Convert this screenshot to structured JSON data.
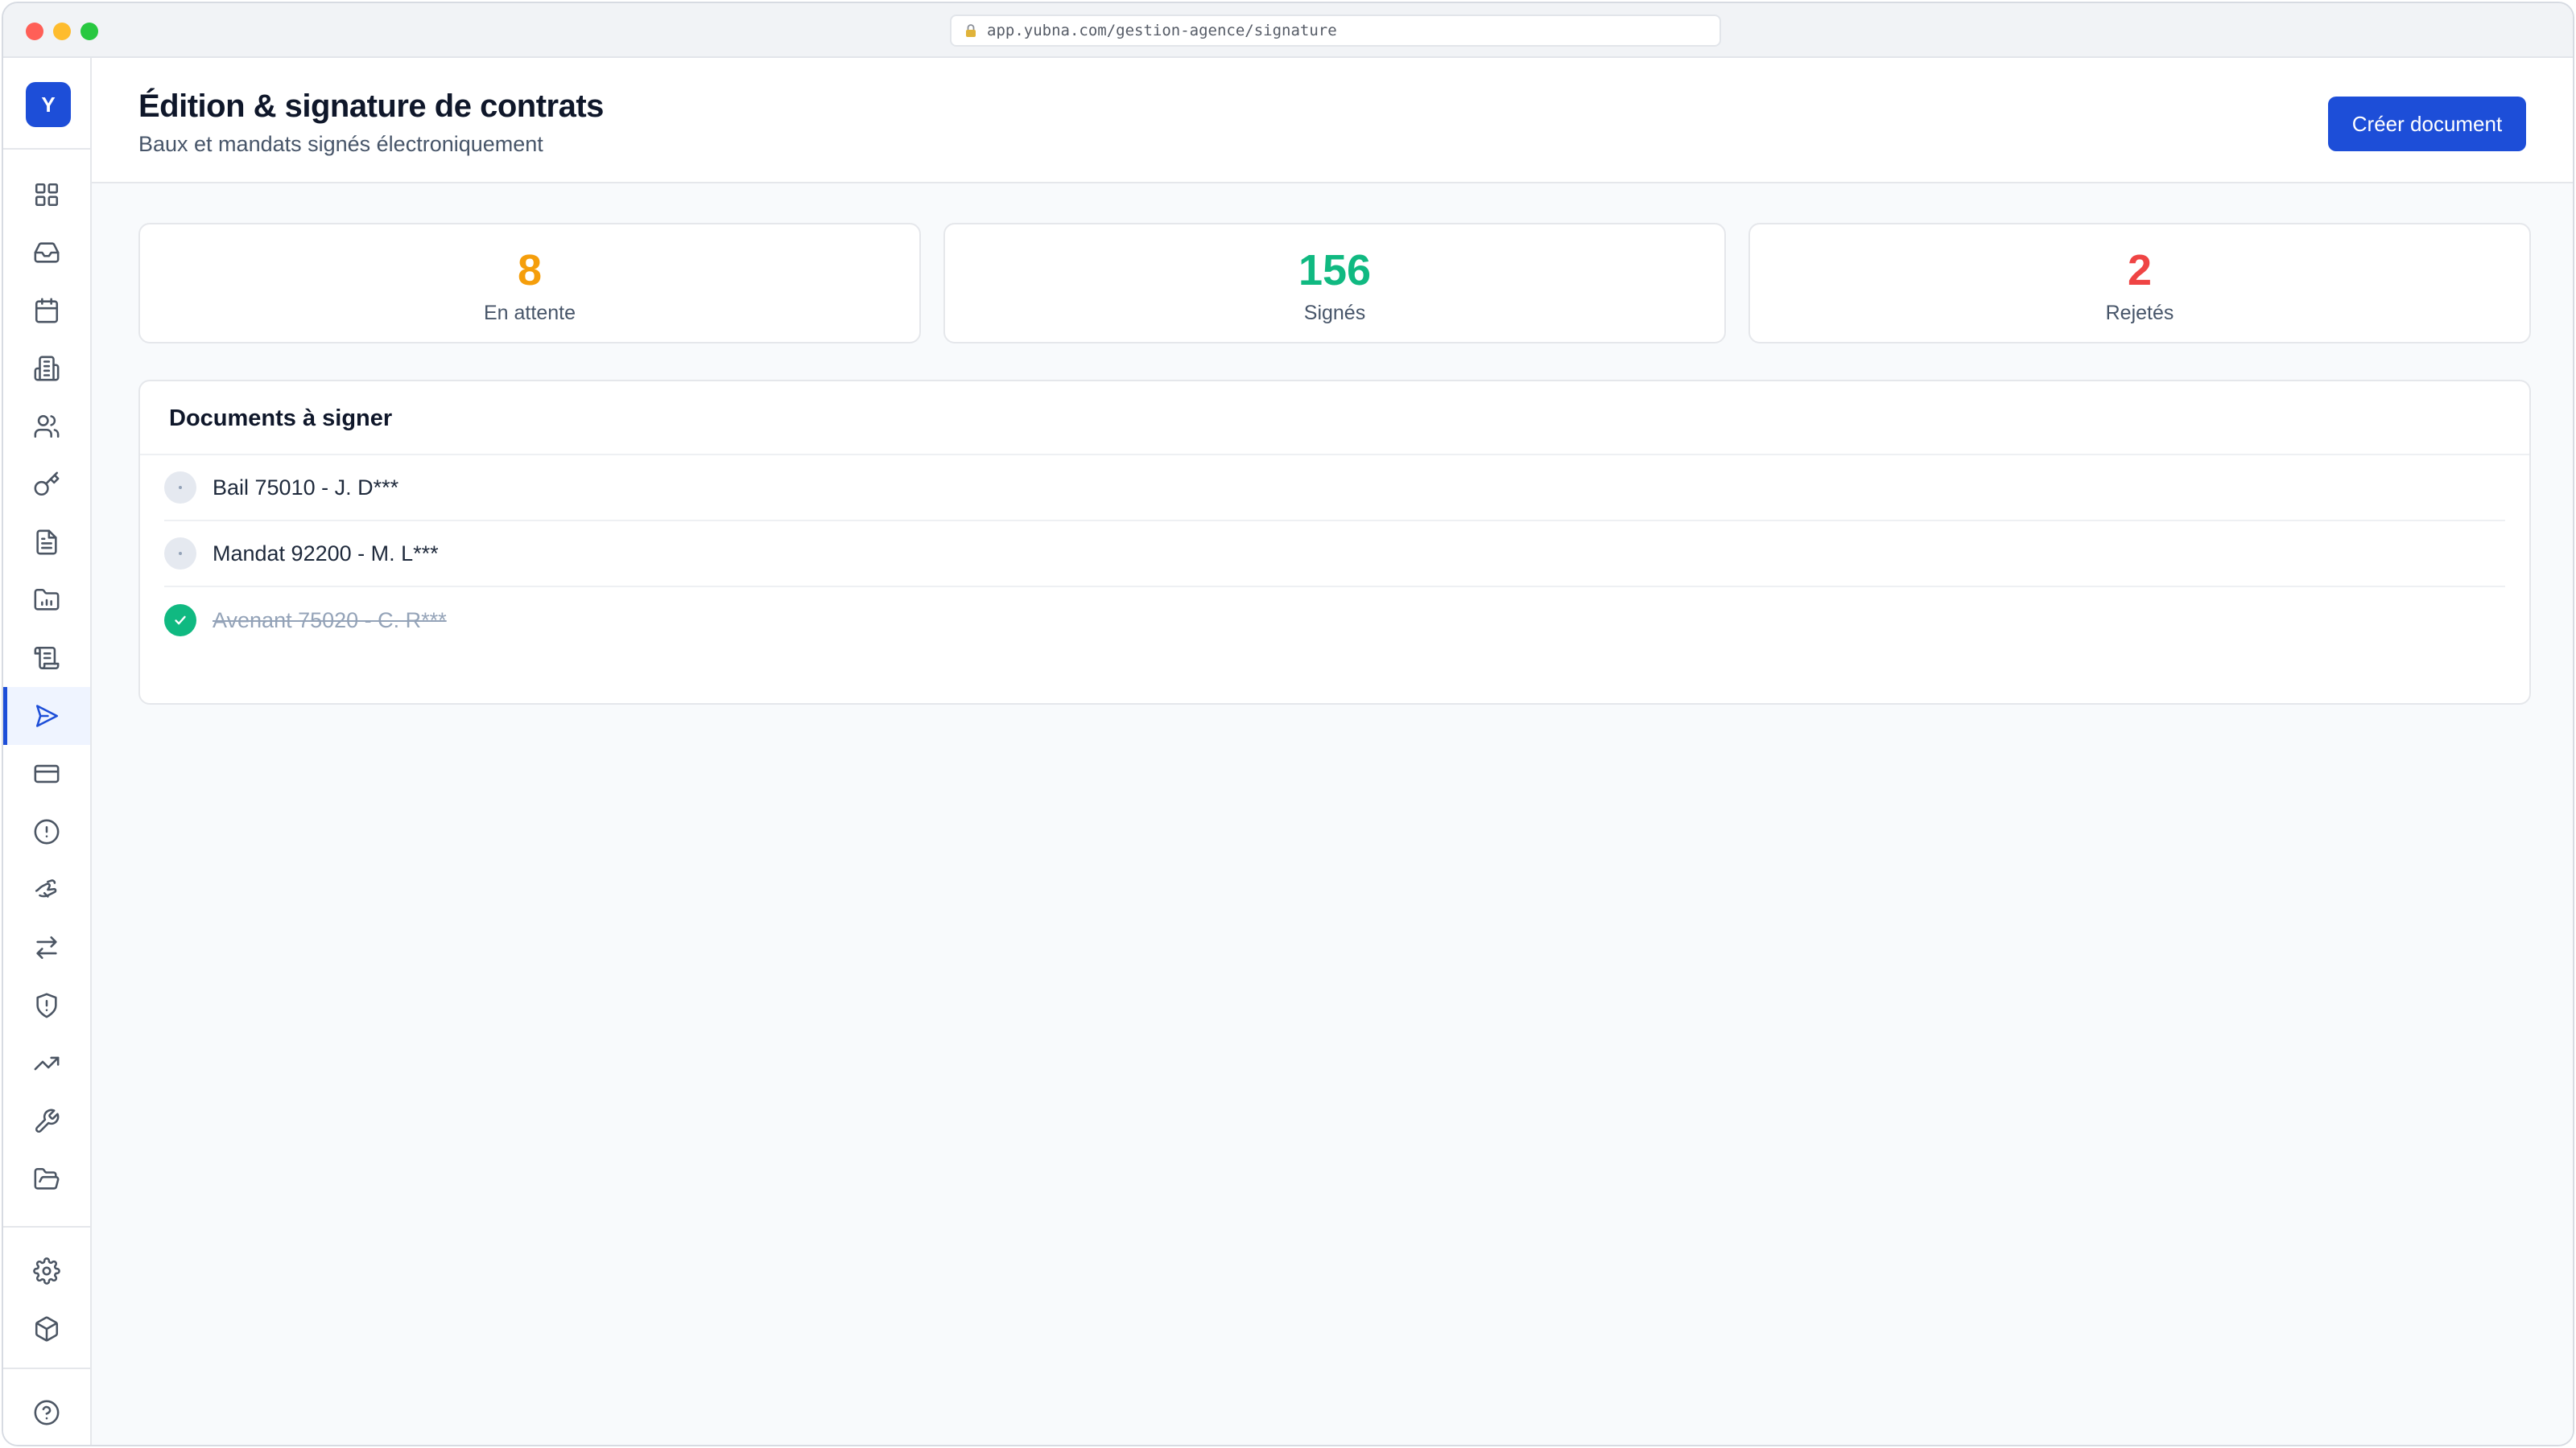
{
  "browser": {
    "url": "app.yubna.com/gestion-agence/signature",
    "lock_icon": "lock-icon"
  },
  "sidebar": {
    "logo": "Y",
    "items": [
      {
        "icon": "dashboard-icon"
      },
      {
        "icon": "inbox-icon"
      },
      {
        "icon": "calendar-icon"
      },
      {
        "icon": "building-icon"
      },
      {
        "icon": "users-icon"
      },
      {
        "icon": "key-icon"
      },
      {
        "icon": "document-icon"
      },
      {
        "icon": "folder-chart-icon"
      },
      {
        "icon": "scroll-icon"
      },
      {
        "icon": "send-icon",
        "active": true
      },
      {
        "icon": "credit-card-icon"
      },
      {
        "icon": "alert-circle-icon"
      },
      {
        "icon": "handshake-icon"
      },
      {
        "icon": "transfer-icon"
      },
      {
        "icon": "shield-alert-icon"
      },
      {
        "icon": "trending-up-icon"
      },
      {
        "icon": "wrench-icon"
      },
      {
        "icon": "folder-open-icon"
      }
    ],
    "bottom_items": [
      {
        "icon": "settings-icon"
      },
      {
        "icon": "package-icon"
      },
      {
        "icon": "help-icon"
      }
    ]
  },
  "header": {
    "title": "Édition & signature de contrats",
    "subtitle": "Baux et mandats signés électroniquement",
    "create_button": "Créer document"
  },
  "stats": [
    {
      "value": "8",
      "label": "En attente",
      "color": "#f59e0b"
    },
    {
      "value": "156",
      "label": "Signés",
      "color": "#10b981"
    },
    {
      "value": "2",
      "label": "Rejetés",
      "color": "#ef4444"
    }
  ],
  "documents": {
    "title": "Documents à signer",
    "items": [
      {
        "name": "Bail 75010 - J. D***",
        "done": false
      },
      {
        "name": "Mandat 92200 - M. L***",
        "done": false
      },
      {
        "name": "Avenant 75020 - C. R***",
        "done": true
      }
    ]
  },
  "colors": {
    "accent": "#1d4ed8",
    "pending": "#f59e0b",
    "signed": "#10b981",
    "rejected": "#ef4444"
  }
}
